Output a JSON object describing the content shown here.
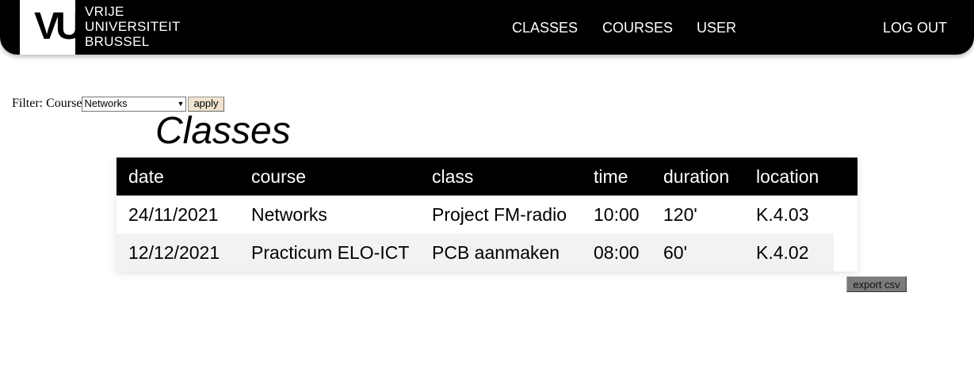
{
  "navbar": {
    "logo": {
      "mark": "VUB",
      "lines": [
        "VRIJE",
        "UNIVERSITEIT",
        "BRUSSEL"
      ]
    },
    "links": [
      "CLASSES",
      "COURSES",
      "USER"
    ],
    "logout": "LOG OUT"
  },
  "filter": {
    "label": "Filter: Course",
    "selected": "Networks",
    "apply_label": "apply"
  },
  "page_title": "Classes",
  "table": {
    "columns": [
      "date",
      "course",
      "class",
      "time",
      "duration",
      "location"
    ],
    "rows": [
      [
        "24/11/2021",
        "Networks",
        "Project FM-radio",
        "10:00",
        "120'",
        "K.4.03"
      ],
      [
        "12/12/2021",
        "Practicum ELO-ICT",
        "PCB aanmaken",
        "08:00",
        "60'",
        "K.4.02"
      ]
    ]
  },
  "export_label": "export csv",
  "colors": {
    "navbar_bg": "#000000",
    "header_text": "#ffffff",
    "row_alt_bg": "#f2f2f2",
    "apply_bg": "#efe3cf",
    "export_bg": "#7b7b7b"
  }
}
